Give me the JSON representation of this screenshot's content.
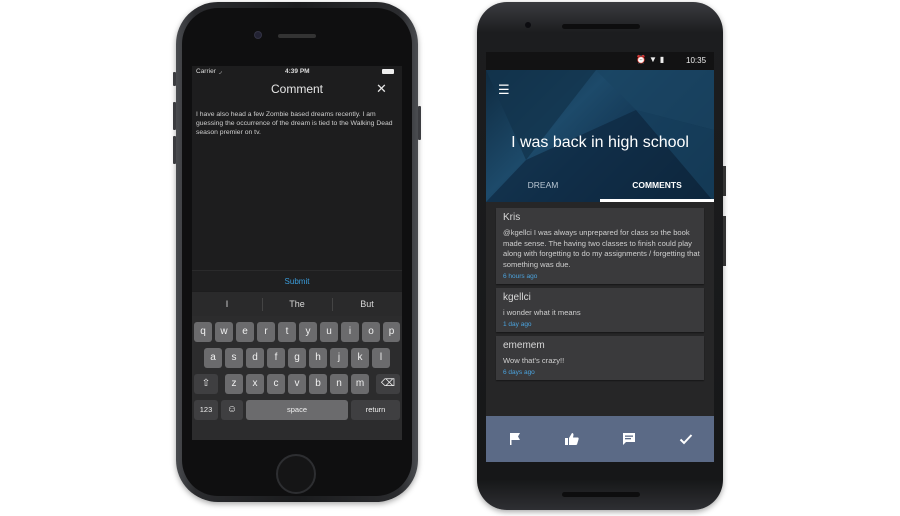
{
  "iphone": {
    "status": {
      "carrier": "Carrier",
      "time": "4:39 PM"
    },
    "nav": {
      "title": "Comment",
      "close_icon": "close-icon"
    },
    "comment_text": "I have also head a few Zombie based dreams recently.  I am guessing the occurrence of the dream is tied to the Walking Dead season premier on tv.",
    "submit_label": "Submit",
    "suggestions": [
      "I",
      "The",
      "But"
    ],
    "keyboard": {
      "row1": [
        "q",
        "w",
        "e",
        "r",
        "t",
        "y",
        "u",
        "i",
        "o",
        "p"
      ],
      "row2": [
        "a",
        "s",
        "d",
        "f",
        "g",
        "h",
        "j",
        "k",
        "l"
      ],
      "row3": [
        "z",
        "x",
        "c",
        "v",
        "b",
        "n",
        "m"
      ],
      "numbers": "123",
      "space": "space",
      "return": "return"
    }
  },
  "android": {
    "status": {
      "time": "10:35"
    },
    "dream_title": "I was back in high school",
    "tabs": [
      "DREAM",
      "COMMENTS"
    ],
    "active_tab": "COMMENTS",
    "comments": [
      {
        "author": "Kris",
        "text": "@kgellci I was always unprepared for class so the book made sense.  The having two classes to finish could play along with forgetting to do my assignments / forgetting that something was due.",
        "time": "6 hours ago"
      },
      {
        "author": "kgellci",
        "text": "i wonder what it means",
        "time": "1 day ago"
      },
      {
        "author": "ememem",
        "text": "Wow that's crazy!!",
        "time": "6 days ago"
      }
    ],
    "actions": [
      "flag-icon",
      "thumbs-up-icon",
      "comment-icon",
      "check-icon"
    ],
    "colors": {
      "accent_blue": "#4ba3de",
      "action_bar": "#5b6a86",
      "hero": "#1d4a6a"
    }
  }
}
